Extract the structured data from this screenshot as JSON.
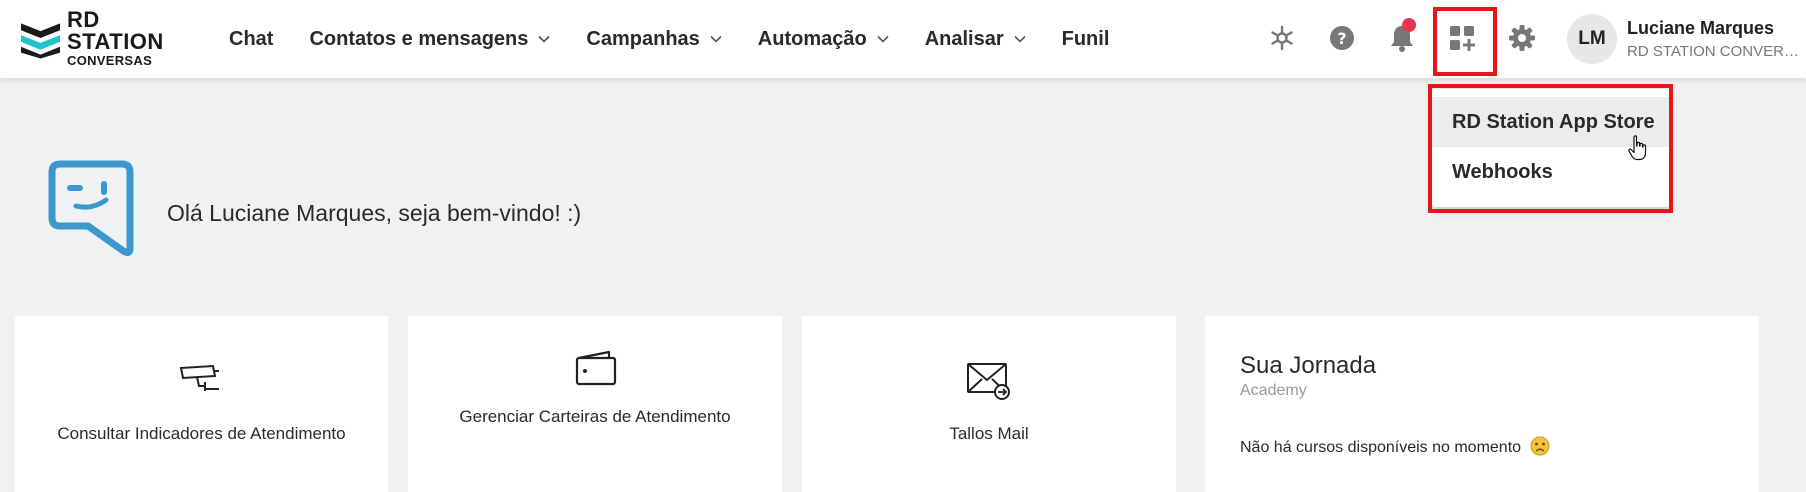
{
  "brand": {
    "name_line1": "RD STATION",
    "name_line2": "CONVERSAS",
    "accent": "#20c4c9",
    "dark": "#1a1a1a"
  },
  "nav": {
    "items": [
      {
        "label": "Chat",
        "dropdown": false
      },
      {
        "label": "Contatos e mensagens",
        "dropdown": true
      },
      {
        "label": "Campanhas",
        "dropdown": true
      },
      {
        "label": "Automação",
        "dropdown": true
      },
      {
        "label": "Analisar",
        "dropdown": true
      },
      {
        "label": "Funil",
        "dropdown": false
      }
    ]
  },
  "toolbar": {
    "icons": [
      "network-icon",
      "help-icon",
      "bell-icon",
      "apps-add-icon",
      "gear-icon"
    ],
    "notification_color": "#e8344e",
    "highlight_color": "#e8141c"
  },
  "user": {
    "initials": "LM",
    "name": "Luciane Marques",
    "org": "RD STATION CONVERS..."
  },
  "apps_menu": {
    "items": [
      "RD Station App Store",
      "Webhooks"
    ],
    "hovered": "RD Station App Store"
  },
  "welcome": {
    "message": "Olá Luciane Marques, seja bem-vindo! :)",
    "icon_color": "#3c97cf"
  },
  "cards": [
    {
      "label": "Consultar Indicadores de Atendimento",
      "icon": "cctv-camera-icon"
    },
    {
      "label": "Gerenciar Carteiras de Atendimento",
      "icon": "wallet-icon"
    },
    {
      "label": "Tallos Mail",
      "icon": "mail-forward-icon"
    }
  ],
  "journey": {
    "title": "Sua Jornada",
    "subtitle": "Academy",
    "message": "Não há cursos disponíveis no momento",
    "emoji": "😥"
  }
}
